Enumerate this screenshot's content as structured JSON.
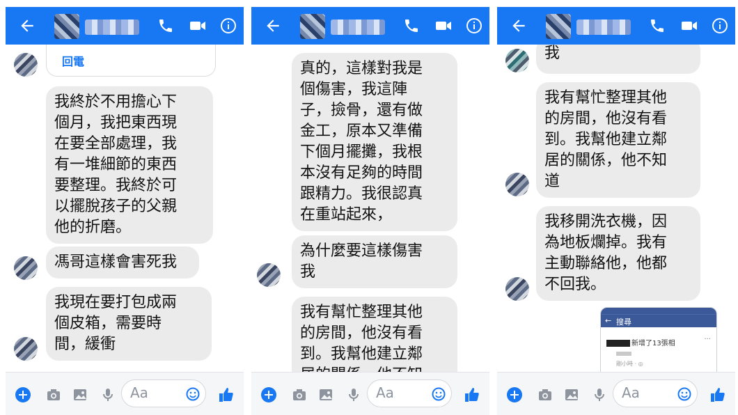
{
  "composer": {
    "placeholder": "Aa"
  },
  "panels": [
    {
      "call_label": "回電",
      "messages": [
        "我終於不用擔心下\n個月，我把東西現\n在要全部處理，我\n有一堆細節的東西\n要整理。我終於可\n以擺脫孩子的父親\n他的折磨。",
        "馮哥這樣會害死我",
        "我現在要打包成兩\n個皮箱，需要時\n間，緩衝"
      ]
    },
    {
      "messages": [
        "真的，這樣對我是\n個傷害，我這陣\n子，撿骨，還有做\n金工，原本又準備\n下個月擺攤，我根\n本沒有足夠的時間\n跟精力。我很認真\n在重站起來，",
        "為什麼要這樣傷害\n我",
        "我有幫忙整理其他\n的房間，他沒有看\n到。我幫他建立鄰\n居的關係，他不知"
      ]
    },
    {
      "messages": [
        "我",
        "我有幫忙整理其他\n的房間，他沒有看\n到。我幫他建立鄰\n居的關係，他不知\n道",
        "我移開洗衣機，因\n為地板爛掉。我有\n主動聯絡他，他都\n不回我。"
      ],
      "embedded_screenshot": {
        "search_label": "搜尋",
        "notification_text": "新增了13張相",
        "time_text": "剛小時 · ◎"
      }
    }
  ]
}
